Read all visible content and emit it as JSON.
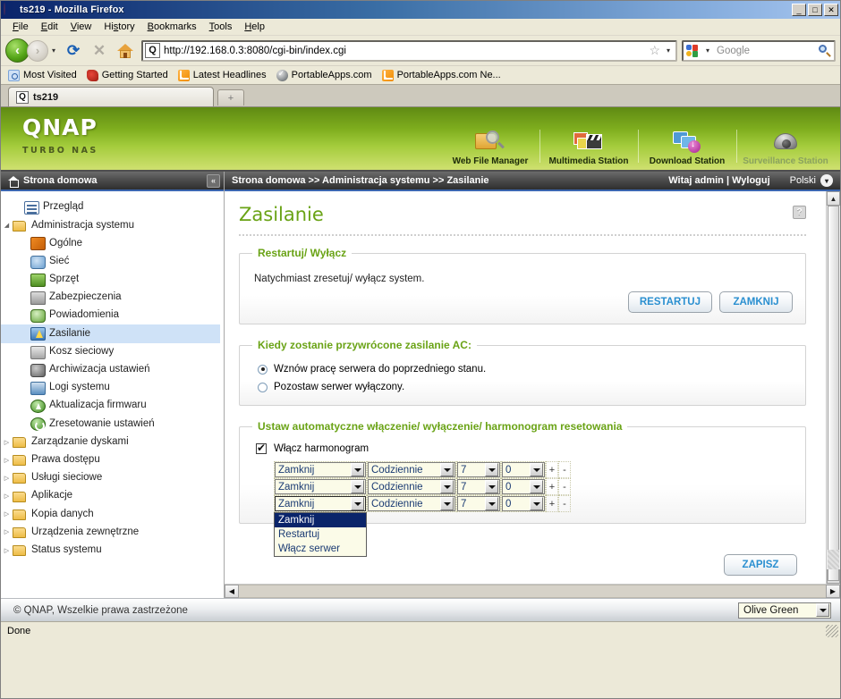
{
  "window": {
    "title": "ts219 - Mozilla Firefox",
    "app_icon": "firefox-icon",
    "minimize": "_",
    "maximize": "□",
    "close": "✕"
  },
  "menubar": [
    {
      "label": "File",
      "accel": "F"
    },
    {
      "label": "Edit",
      "accel": "E"
    },
    {
      "label": "View",
      "accel": "V"
    },
    {
      "label": "History",
      "accel": "s"
    },
    {
      "label": "Bookmarks",
      "accel": "B"
    },
    {
      "label": "Tools",
      "accel": "T"
    },
    {
      "label": "Help",
      "accel": "H"
    }
  ],
  "toolbar": {
    "back_icon": "‹",
    "forward_icon": "›",
    "history_caret": "▾",
    "reload_icon": "⟳",
    "stop_icon": "✕",
    "home_icon": "home-icon",
    "url": "http://192.168.0.3:8080/cgi-bin/index.cgi",
    "url_favicon": "Q",
    "bookmark_star": "☆",
    "url_caret": "▾",
    "search_placeholder": "Google",
    "search_engine_caret": "▾"
  },
  "bookmarks": [
    {
      "label": "Most Visited",
      "icon": "most-visited-icon"
    },
    {
      "label": "Getting Started",
      "icon": "firefox-icon"
    },
    {
      "label": "Latest Headlines",
      "icon": "rss-icon"
    },
    {
      "label": "PortableApps.com",
      "icon": "portableapps-icon"
    },
    {
      "label": "PortableApps.com Ne...",
      "icon": "rss-icon"
    }
  ],
  "tabs": {
    "active": {
      "label": "ts219",
      "icon": "Q"
    },
    "new_tab_icon": "+"
  },
  "qnap": {
    "logo": "QNAP",
    "tagline": "TURBO NAS",
    "apps": [
      {
        "label": "Web File Manager",
        "icon": "web-file-manager-icon",
        "disabled": false
      },
      {
        "label": "Multimedia Station",
        "icon": "multimedia-station-icon",
        "disabled": false
      },
      {
        "label": "Download Station",
        "icon": "download-station-icon",
        "disabled": false
      },
      {
        "label": "Surveillance Station",
        "icon": "surveillance-station-icon",
        "disabled": true
      }
    ]
  },
  "sidebar": {
    "header": "Strona domowa",
    "collapse_icon": "«",
    "items": [
      {
        "label": "Przegląd",
        "icon": "overview-icon",
        "indent": 1,
        "twisty": "",
        "selected": false,
        "type": "leaf"
      },
      {
        "label": "Administracja systemu",
        "icon": "folder-icon",
        "indent": 0,
        "twisty": "◢",
        "selected": false,
        "type": "folder-open"
      },
      {
        "label": "Ogólne",
        "icon": "general-icon",
        "indent": 2,
        "twisty": "",
        "selected": false,
        "type": "leaf"
      },
      {
        "label": "Sieć",
        "icon": "network-icon",
        "indent": 2,
        "twisty": "",
        "selected": false,
        "type": "leaf"
      },
      {
        "label": "Sprzęt",
        "icon": "hardware-icon",
        "indent": 2,
        "twisty": "",
        "selected": false,
        "type": "leaf"
      },
      {
        "label": "Zabezpieczenia",
        "icon": "security-icon",
        "indent": 2,
        "twisty": "",
        "selected": false,
        "type": "leaf"
      },
      {
        "label": "Powiadomienia",
        "icon": "notification-icon",
        "indent": 2,
        "twisty": "",
        "selected": false,
        "type": "leaf"
      },
      {
        "label": "Zasilanie",
        "icon": "power-icon",
        "indent": 2,
        "twisty": "",
        "selected": true,
        "type": "leaf"
      },
      {
        "label": "Kosz sieciowy",
        "icon": "network-recycle-bin-icon",
        "indent": 2,
        "twisty": "",
        "selected": false,
        "type": "leaf"
      },
      {
        "label": "Archiwizacja ustawień",
        "icon": "backup-settings-icon",
        "indent": 2,
        "twisty": "",
        "selected": false,
        "type": "leaf"
      },
      {
        "label": "Logi systemu",
        "icon": "system-logs-icon",
        "indent": 2,
        "twisty": "",
        "selected": false,
        "type": "leaf"
      },
      {
        "label": "Aktualizacja firmwaru",
        "icon": "firmware-update-icon",
        "indent": 2,
        "twisty": "",
        "selected": false,
        "type": "leaf"
      },
      {
        "label": "Zresetowanie ustawień",
        "icon": "reset-settings-icon",
        "indent": 2,
        "twisty": "",
        "selected": false,
        "type": "leaf"
      },
      {
        "label": "Zarządzanie dyskami",
        "icon": "folder-icon",
        "indent": 0,
        "twisty": "▷",
        "selected": false,
        "type": "folder"
      },
      {
        "label": "Prawa dostępu",
        "icon": "folder-icon",
        "indent": 0,
        "twisty": "▷",
        "selected": false,
        "type": "folder"
      },
      {
        "label": "Usługi sieciowe",
        "icon": "folder-icon",
        "indent": 0,
        "twisty": "▷",
        "selected": false,
        "type": "folder"
      },
      {
        "label": "Aplikacje",
        "icon": "folder-icon",
        "indent": 0,
        "twisty": "▷",
        "selected": false,
        "type": "folder"
      },
      {
        "label": "Kopia danych",
        "icon": "folder-icon",
        "indent": 0,
        "twisty": "▷",
        "selected": false,
        "type": "folder"
      },
      {
        "label": "Urządzenia zewnętrzne",
        "icon": "folder-icon",
        "indent": 0,
        "twisty": "▷",
        "selected": false,
        "type": "folder"
      },
      {
        "label": "Status systemu",
        "icon": "folder-icon",
        "indent": 0,
        "twisty": "▷",
        "selected": false,
        "type": "folder"
      }
    ]
  },
  "topbar": {
    "breadcrumb": "Strona domowa >> Administracja systemu >> Zasilanie",
    "welcome": "Witaj admin | Wyloguj",
    "language": "Polski",
    "language_caret": "▾"
  },
  "main": {
    "page_title": "Zasilanie",
    "help_icon": "?",
    "restart_section": {
      "legend": "Restartuj/ Wyłącz",
      "description": "Natychmiast zresetuj/ wyłącz system.",
      "restart_button": "RESTARTUJ",
      "shutdown_button": "ZAMKNIJ"
    },
    "ac_section": {
      "legend": "Kiedy zostanie przywrócone zasilanie AC:",
      "options": [
        {
          "label": "Wznów pracę serwera do poprzedniego stanu.",
          "selected": true
        },
        {
          "label": "Pozostaw serwer wyłączony.",
          "selected": false
        }
      ]
    },
    "schedule_section": {
      "legend": "Ustaw automatyczne włączenie/ wyłączenie/ harmonogram resetowania",
      "enable_label": "Włącz harmonogram",
      "enable_checked": true,
      "rows": [
        {
          "action": "Zamknij",
          "frequency": "Codziennie",
          "hour": "7",
          "minute": "0",
          "add": "+",
          "remove": "-",
          "focused": false
        },
        {
          "action": "Zamknij",
          "frequency": "Codziennie",
          "hour": "7",
          "minute": "0",
          "add": "+",
          "remove": "-",
          "focused": false
        },
        {
          "action": "Zamknij",
          "frequency": "Codziennie",
          "hour": "7",
          "minute": "0",
          "add": "+",
          "remove": "-",
          "focused": true
        }
      ],
      "open_dropdown": {
        "row_index": 2,
        "options": [
          {
            "label": "Zamknij",
            "selected": true
          },
          {
            "label": "Restartuj",
            "selected": false
          },
          {
            "label": "Włącz serwer",
            "selected": false
          }
        ]
      }
    },
    "save_button": "ZAPISZ"
  },
  "qnap_footer": {
    "copyright": "© QNAP, Wszelkie prawa zastrzeżone",
    "theme": "Olive Green",
    "theme_caret": "▾"
  },
  "statusbar": {
    "text": "Done"
  },
  "scroll": {
    "up_arrow": "▲",
    "down_arrow": "▼",
    "left_arrow": "◀",
    "right_arrow": "▶"
  },
  "colors": {
    "qnap_green": "#6aa316",
    "accent_blue": "#2a8fd0",
    "header_green_top": "#5f8a13",
    "header_green_bottom": "#cfe070",
    "selection_blue": "#cfe2f7",
    "dropdown_highlight": "#0a246a",
    "titlebar_blue": "#0a246a"
  }
}
